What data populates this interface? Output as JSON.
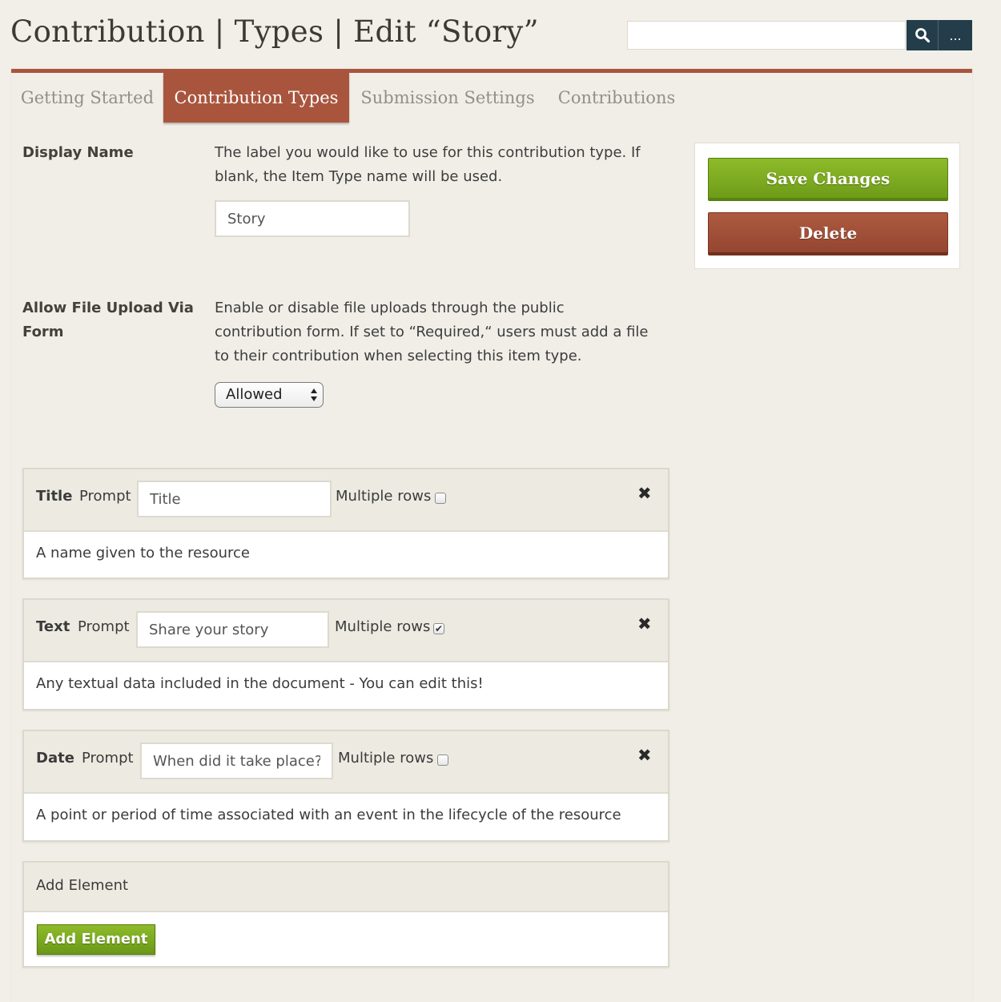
{
  "header": {
    "title": "Contribution | Types | Edit “Story”",
    "search_value": "",
    "search_icon": "search-icon",
    "more_label": "..."
  },
  "tabs": [
    {
      "label": "Getting Started",
      "active": false
    },
    {
      "label": "Contribution Types",
      "active": true
    },
    {
      "label": "Submission Settings",
      "active": false
    },
    {
      "label": "Contributions",
      "active": false
    }
  ],
  "form": {
    "display_name": {
      "label": "Display Name",
      "description": "The label you would like to use for this contribution type. If blank, the Item Type name will be used.",
      "value": "Story"
    },
    "file_upload": {
      "label": "Allow File Upload Via Form",
      "description": "Enable or disable file uploads through the public contribution form. If set to “Required,“ users must add a file to their contribution when selecting this item type.",
      "selected": "Allowed"
    }
  },
  "actions": {
    "save_label": "Save Changes",
    "delete_label": "Delete"
  },
  "elements": [
    {
      "name": "Title",
      "prompt_label": "Prompt",
      "prompt_value": "Title",
      "multiple_label": "Multiple rows",
      "multiple_checked": false,
      "remove_symbol": "✖",
      "description": "A name given to the resource"
    },
    {
      "name": "Text",
      "prompt_label": "Prompt",
      "prompt_value": "Share your story",
      "multiple_label": "Multiple rows",
      "multiple_checked": true,
      "remove_symbol": "✖",
      "description": "Any textual data included in the document - You can edit this!"
    },
    {
      "name": "Date",
      "prompt_label": "Prompt",
      "prompt_value": "When did it take place?",
      "multiple_label": "Multiple rows",
      "multiple_checked": false,
      "remove_symbol": "✖",
      "description": "A point or period of time associated with an event in the lifecycle of the resource"
    }
  ],
  "add_element": {
    "heading": "Add Element",
    "button_label": "Add Element"
  },
  "colors": {
    "accent": "#a9553e",
    "primary_button": "#7aa820",
    "search_button": "#233d4a"
  }
}
